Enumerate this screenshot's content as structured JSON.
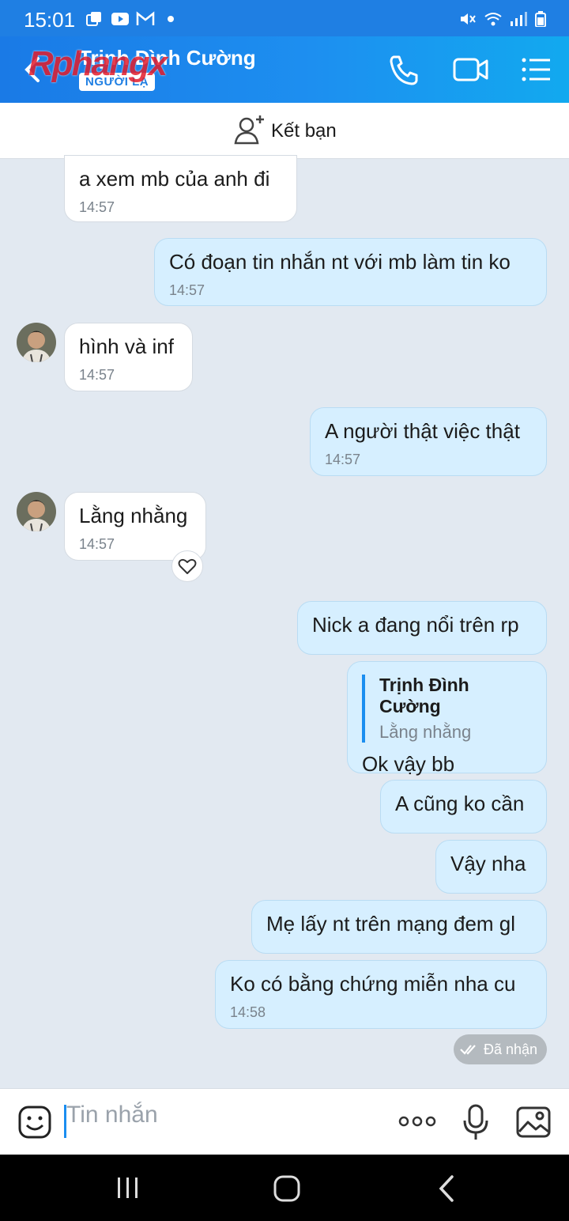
{
  "status_bar": {
    "time": "15:01"
  },
  "header": {
    "contact_name": "Trịnh Đình Cường",
    "badge": "NGƯỜI LẠ",
    "watermark": "Rphangx"
  },
  "friend_bar": {
    "label": "Kết bạn"
  },
  "messages": [
    {
      "dir": "in",
      "text": "a xem mb của anh đi",
      "time": "14:57"
    },
    {
      "dir": "out",
      "text": "Có đoạn tin nhắn nt với mb làm tin ko",
      "time": "14:57"
    },
    {
      "dir": "in",
      "text": "hình và inf",
      "time": "14:57"
    },
    {
      "dir": "out",
      "text": "A người thật việc thật",
      "time": "14:57"
    },
    {
      "dir": "in",
      "text": "Lằng nhằng",
      "time": "14:57"
    },
    {
      "dir": "out",
      "text": "Nick a đang nổi trên rp"
    },
    {
      "dir": "out",
      "text": "Ok vậy bb",
      "quote_name": "Trịnh Đình Cường",
      "quote_text": "Lằng nhằng"
    },
    {
      "dir": "out",
      "text": "A cũng ko cần"
    },
    {
      "dir": "out",
      "text": "Vậy nha"
    },
    {
      "dir": "out",
      "text": "Mẹ lấy nt trên mạng đem gl"
    },
    {
      "dir": "out",
      "text": "Ko có bằng chứng miễn nha cu",
      "time": "14:58"
    }
  ],
  "received_label": "Đã nhận",
  "input": {
    "placeholder": "Tin nhắn"
  },
  "colors": {
    "header": "#1f7fe3",
    "outgoing": "#d6efff",
    "incoming": "#ffffff",
    "background": "#e2e9f1"
  }
}
